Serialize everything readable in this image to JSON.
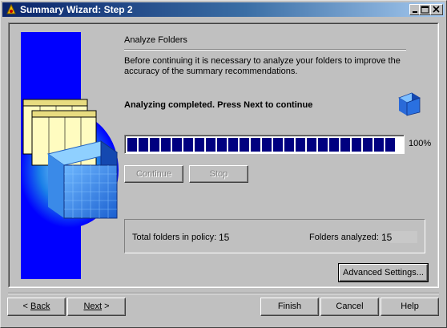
{
  "window": {
    "title": "Summary Wizard: Step 2"
  },
  "page": {
    "heading": "Analyze Folders",
    "description": "Before continuing it is necessary to analyze your folders to improve the accuracy of the summary recommendations.",
    "status": "Analyzing completed. Press Next to continue"
  },
  "progress": {
    "value": 1.0,
    "label": "100%"
  },
  "actions": {
    "continue_label": "Continue",
    "stop_label": "Stop"
  },
  "summary": {
    "total_label": "Total folders in policy:",
    "total_value": "15",
    "analyzed_label": "Folders analyzed:",
    "analyzed_value": "15"
  },
  "advanced_label": "Advanced Settings...",
  "footer": {
    "back_label": "Back",
    "next_label": "Next",
    "finish_label": "Finish",
    "cancel_label": "Cancel",
    "help_label": "Help"
  },
  "colors": {
    "title_bar_start": "#0a246a",
    "title_bar_end": "#a6caf0",
    "progress_fill": "#000080",
    "side_panel": "#0000ff",
    "background": "#c0c0c0"
  },
  "icons": [
    "app-icon",
    "minimize-icon",
    "maximize-icon",
    "close-icon",
    "cube-icon"
  ]
}
